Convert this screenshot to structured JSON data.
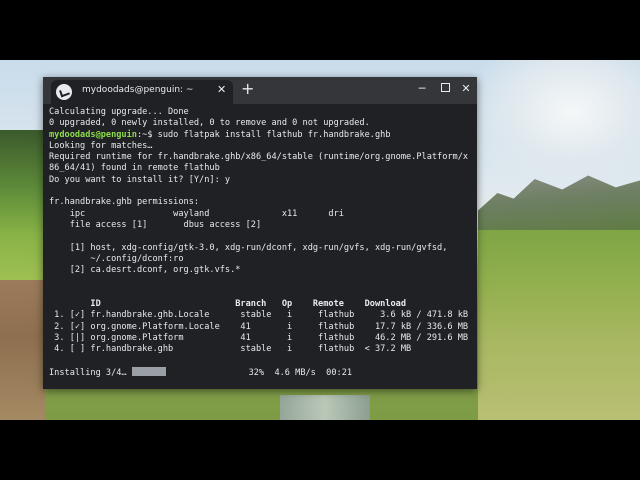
{
  "window": {
    "tab_title": "mydoodads@penguin: ~",
    "tab_close": "✕",
    "new_tab": "+",
    "minimize": "─",
    "close": "✕"
  },
  "terminal": {
    "line1": "Calculating upgrade... Done",
    "line2": "0 upgraded, 0 newly installed, 0 to remove and 0 not upgraded.",
    "prompt_user": "mydoodads@penguin",
    "prompt_rest": ":~$ sudo flatpak install flathub fr.handbrake.ghb",
    "line4": "Looking for matches…",
    "line5": "Required runtime for fr.handbrake.ghb/x86_64/stable (runtime/org.gnome.Platform/x",
    "line6": "86_64/41) found in remote flathub",
    "line7": "Do you want to install it? [Y/n]: y",
    "line8": "",
    "line9": "fr.handbrake.ghb permissions:",
    "line10": "    ipc                 wayland              x11      dri",
    "line11": "    file access [1]       dbus access [2]",
    "line12": "",
    "line13": "    [1] host, xdg-config/gtk-3.0, xdg-run/dconf, xdg-run/gvfs, xdg-run/gvfsd,",
    "line14": "        ~/.config/dconf:ro",
    "line15": "    [2] ca.desrt.dconf, org.gtk.vfs.*",
    "table_header": "        ID                          Branch   Op    Remote    Download",
    "rows": [
      " 1. [✓] fr.handbrake.ghb.Locale      stable   i     flathub     3.6 kB / 471.8 kB",
      " 2. [✓] org.gnome.Platform.Locale    41       i     flathub    17.7 kB / 336.6 MB",
      " 3. [|] org.gnome.Platform           41       i     flathub    46.2 MB / 291.6 MB",
      " 4. [ ] fr.handbrake.ghb             stable   i     flathub  < 37.2 MB"
    ],
    "status_label": "Installing 3/4… ",
    "status_rest": "                32%  4.6 MB/s  00:21",
    "progress_fraction": 0.32
  }
}
